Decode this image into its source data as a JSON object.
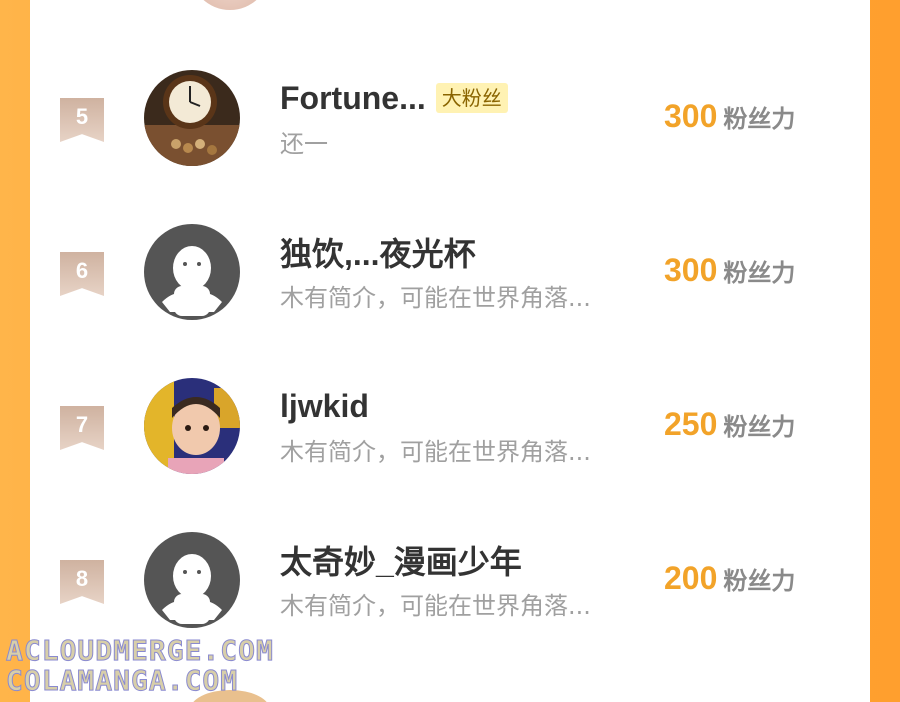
{
  "ranking": [
    {
      "rank": "5",
      "name": "Fortune...",
      "tag": "大粉丝",
      "bio": "还一",
      "score": "300",
      "unit": "粉丝力",
      "avatar": "clock-photo"
    },
    {
      "rank": "6",
      "name": "独饮,...夜光杯",
      "tag": "",
      "bio": "木有简介，可能在世界角落...",
      "score": "300",
      "unit": "粉丝力",
      "avatar": "default-ghost"
    },
    {
      "rank": "7",
      "name": "ljwkid",
      "tag": "",
      "bio": "木有简介，可能在世界角落...",
      "score": "250",
      "unit": "粉丝力",
      "avatar": "child-photo"
    },
    {
      "rank": "8",
      "name": "太奇妙_漫画少年",
      "tag": "",
      "bio": "木有简介，可能在世界角落...",
      "score": "200",
      "unit": "粉丝力",
      "avatar": "default-ghost"
    }
  ],
  "watermark": {
    "line1": "ACLOUDMERGE.COM",
    "line2": "COLAMANGA.COM"
  },
  "colors": {
    "accent": "#f2a329",
    "tag_bg": "#fff2b3",
    "badge": "#d4b9a6"
  }
}
